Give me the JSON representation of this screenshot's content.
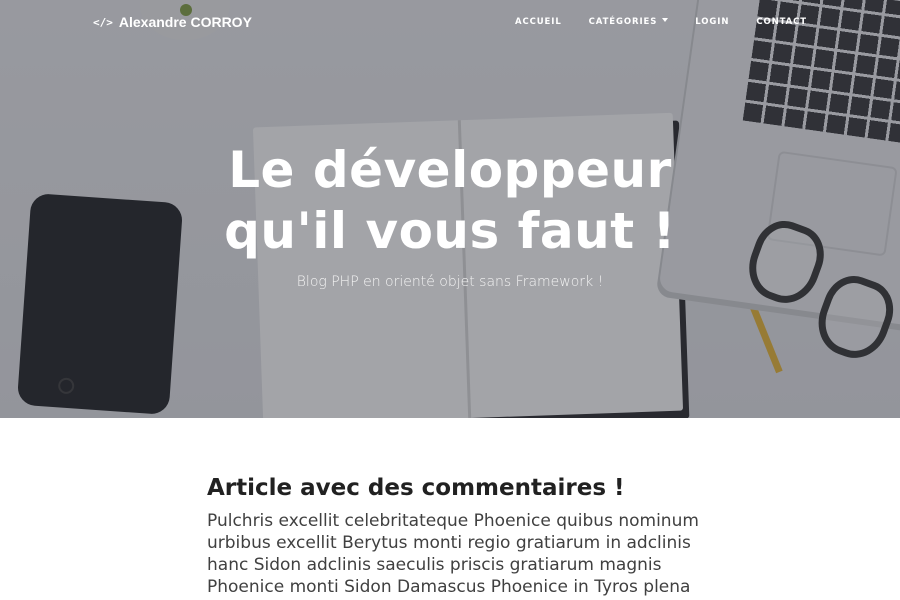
{
  "navbar": {
    "brand_icon": "</>",
    "brand": "Alexandre CORROY",
    "links": [
      "ACCUEIL",
      "CATÉGORIES",
      "LOGIN",
      "CONTACT"
    ]
  },
  "hero": {
    "title_line1": "Le développeur",
    "title_line2": "qu'il vous faut !",
    "subtitle": "Blog PHP en orienté objet sans Framework !"
  },
  "article": {
    "title": "Article avec des commentaires !",
    "excerpt": "Pulchris excellit celebritateque Phoenice quibus nominum urbibus excellit Berytus monti regio gratiarum in adclinis hanc Sidon adclinis saeculis priscis gratiarum magnis Phoenice monti Sidon Damascus Phoenice in Tyros plena"
  },
  "colors": {
    "hero_overlay": "#5f6168",
    "text_dark": "#212121",
    "text_body": "#404040"
  }
}
